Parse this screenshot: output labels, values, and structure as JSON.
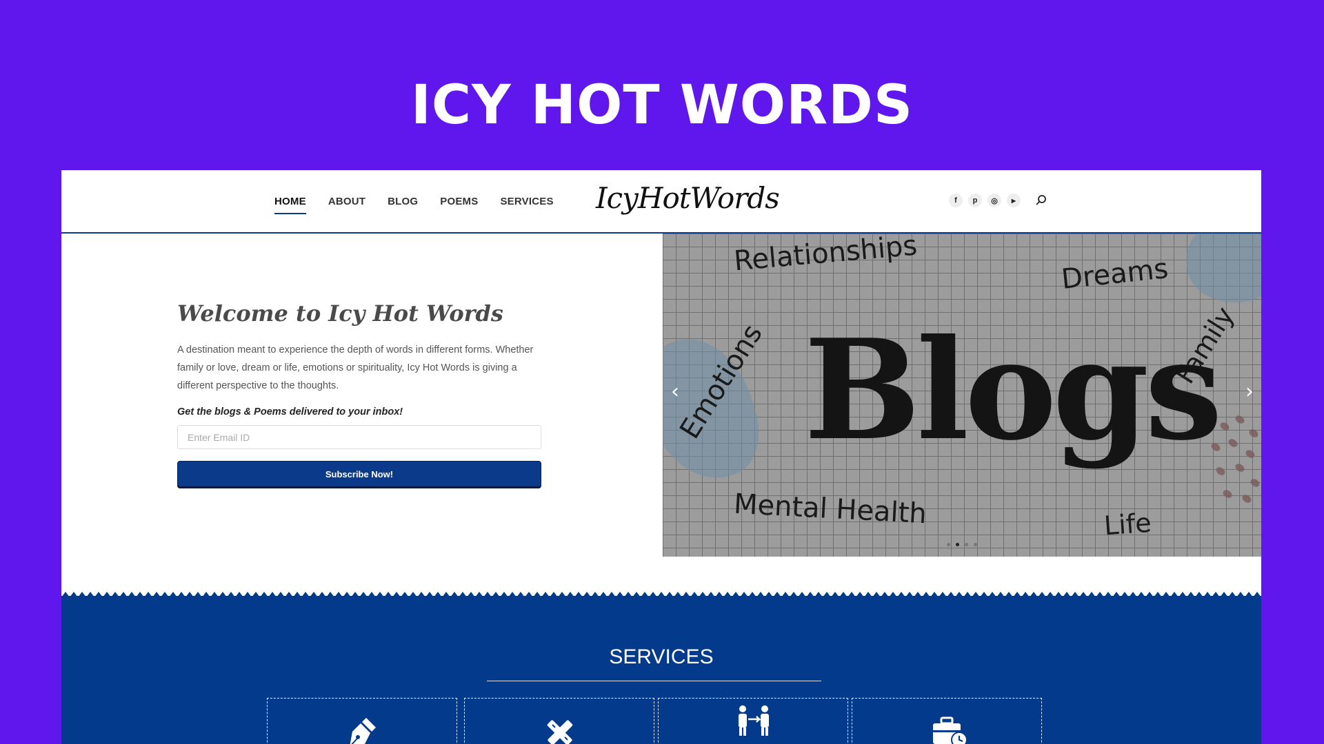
{
  "banner": {
    "title": "ICY HOT WORDS"
  },
  "header": {
    "nav": [
      "HOME",
      "ABOUT",
      "BLOG",
      "POEMS",
      "SERVICES"
    ],
    "active_nav": "HOME",
    "logo": "IcyHotWords",
    "social": [
      {
        "icon": "facebook-icon",
        "glyph": "f"
      },
      {
        "icon": "pinterest-icon",
        "glyph": "p"
      },
      {
        "icon": "instagram-icon",
        "glyph": "◎"
      },
      {
        "icon": "youtube-icon",
        "glyph": "▶"
      }
    ],
    "search_icon": "search-icon"
  },
  "hero": {
    "heading": "Welcome to Icy Hot Words",
    "intro": "A destination meant to experience the depth of words in different forms. Whether family or love, dream or life, emotions or spirituality, Icy Hot Words is giving a different perspective to the thoughts.",
    "cta": "Get the blogs & Poems delivered to your inbox!",
    "email_placeholder": "Enter Email ID",
    "email_value": "",
    "subscribe_label": "Subscribe Now!"
  },
  "slider": {
    "main_word": "Blogs",
    "words": {
      "relationships": "Relationships",
      "dreams": "Dreams",
      "family": "Family",
      "emotions": "Emotions",
      "mental_health": "Mental Health",
      "life": "Life"
    },
    "prev_arrow": "‹",
    "next_arrow": "›",
    "slide_count": 4,
    "active_slide": 2
  },
  "services": {
    "title": "SERVICES",
    "cards": [
      {
        "icon": "pen-nib-icon"
      },
      {
        "icon": "pencil-ruler-icon"
      },
      {
        "icon": "people-exchange-icon"
      },
      {
        "icon": "briefcase-clock-icon"
      }
    ]
  },
  "colors": {
    "page_bg": "#5f17ee",
    "brand_blue": "#0b3a8a",
    "services_bg": "#033a8c"
  }
}
